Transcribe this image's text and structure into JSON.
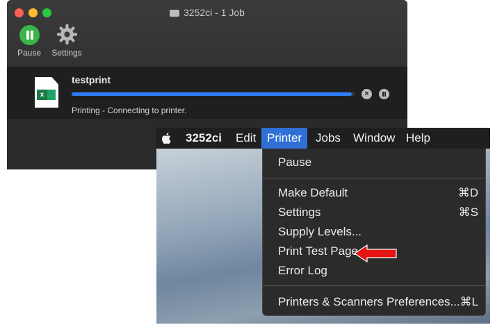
{
  "queue_window": {
    "title": "3252ci - 1 Job",
    "toolbar": {
      "pause_label": "Pause",
      "settings_label": "Settings"
    },
    "job": {
      "name": "testprint",
      "file_icon": "excel-file-icon",
      "progress": 0.99,
      "status": "Printing - Connecting to printer."
    },
    "colors": {
      "progress": "#2e7cf6",
      "pause_green": "#39b54a"
    }
  },
  "menu_bar": {
    "app_name": "3252ci",
    "items": [
      "Edit",
      "Printer",
      "Jobs",
      "Window",
      "Help"
    ],
    "active": "Printer",
    "highlight_color": "#2f6fd6"
  },
  "printer_menu": {
    "pause": "Pause",
    "make_default": {
      "label": "Make Default",
      "shortcut": "⌘D"
    },
    "settings": {
      "label": "Settings",
      "shortcut": "⌘S"
    },
    "supply_levels": "Supply Levels...",
    "print_test_page": "Print Test Page",
    "error_log": "Error Log",
    "printers_prefs": {
      "label": "Printers & Scanners Preferences...",
      "shortcut": "⌘L"
    }
  },
  "annotation": {
    "arrow_color": "#e81414",
    "points_to": "Print Test Page"
  }
}
